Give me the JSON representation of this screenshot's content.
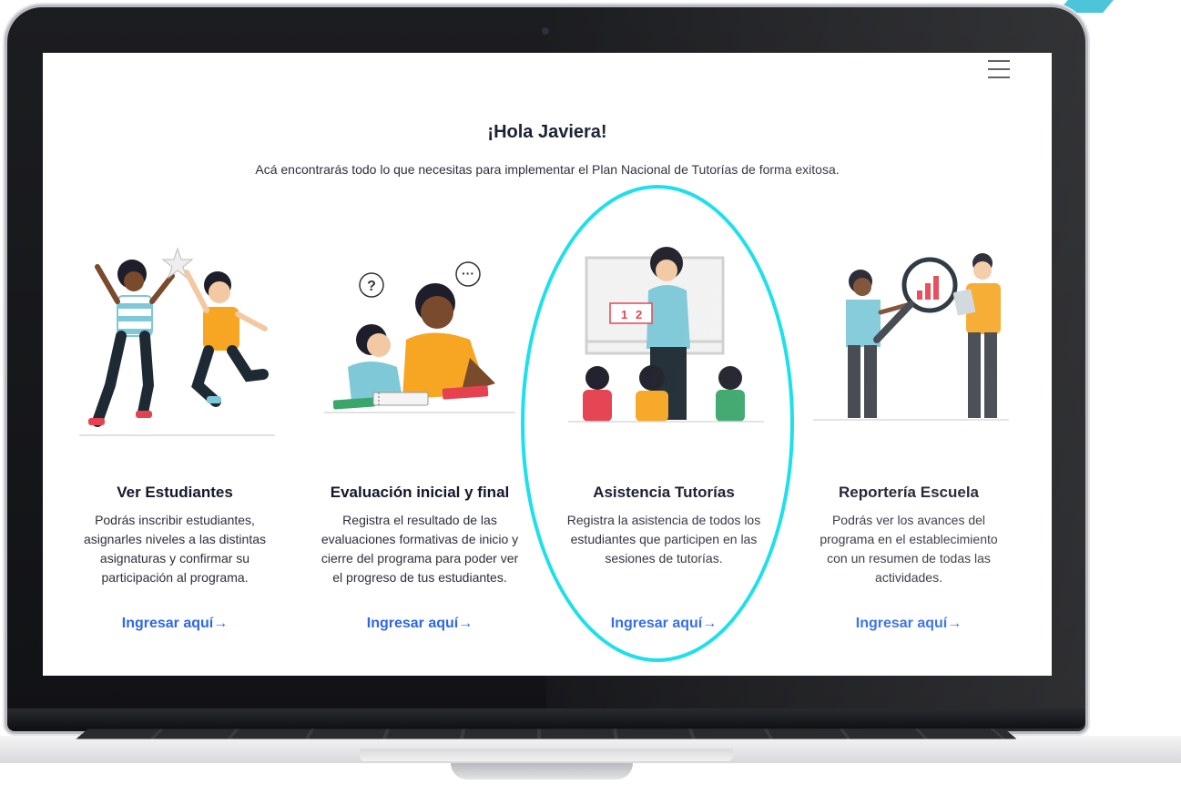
{
  "header": {
    "greeting": "¡Hola Javiera!",
    "subtitle": "Acá encontrarás todo lo que necesitas para implementar el Plan Nacional de Tutorías de forma exitosa."
  },
  "menu": {
    "icon": "hamburger-menu-icon"
  },
  "cards": [
    {
      "title": "Ver Estudiantes",
      "desc": [
        "Podrás inscribir estudiantes,",
        "asignarles niveles a las distintas",
        "asignaturas y confirmar su",
        "participación al programa."
      ],
      "link": "Ingresar aquí",
      "link_arrow": "→"
    },
    {
      "title": "Evaluación inicial y final",
      "desc": [
        "Registra el resultado de las",
        "evaluaciones formativas de inicio y",
        "cierre del programa para poder ver",
        "el progreso de tus estudiantes."
      ],
      "link": "Ingresar aquí",
      "link_arrow": "→"
    },
    {
      "title": "Asistencia Tutorías",
      "desc": [
        "Registra la asistencia de todos los",
        "estudiantes que participen en las",
        "sesiones de tutorías."
      ],
      "link": "Ingresar aquí",
      "link_arrow": "→"
    },
    {
      "title": "Reportería Escuela",
      "desc": [
        "Podrás ver los avances del",
        "programa en el establecimiento",
        "con un resumen de todas las",
        "actividades."
      ],
      "link": "Ingresar aquí",
      "link_arrow": "→"
    }
  ],
  "colors": {
    "link": "#2e68e6",
    "highlight": "#1de0ea",
    "accent_orange": "#f6a623",
    "accent_teal": "#7ec8d8",
    "accent_red": "#e5414f"
  }
}
